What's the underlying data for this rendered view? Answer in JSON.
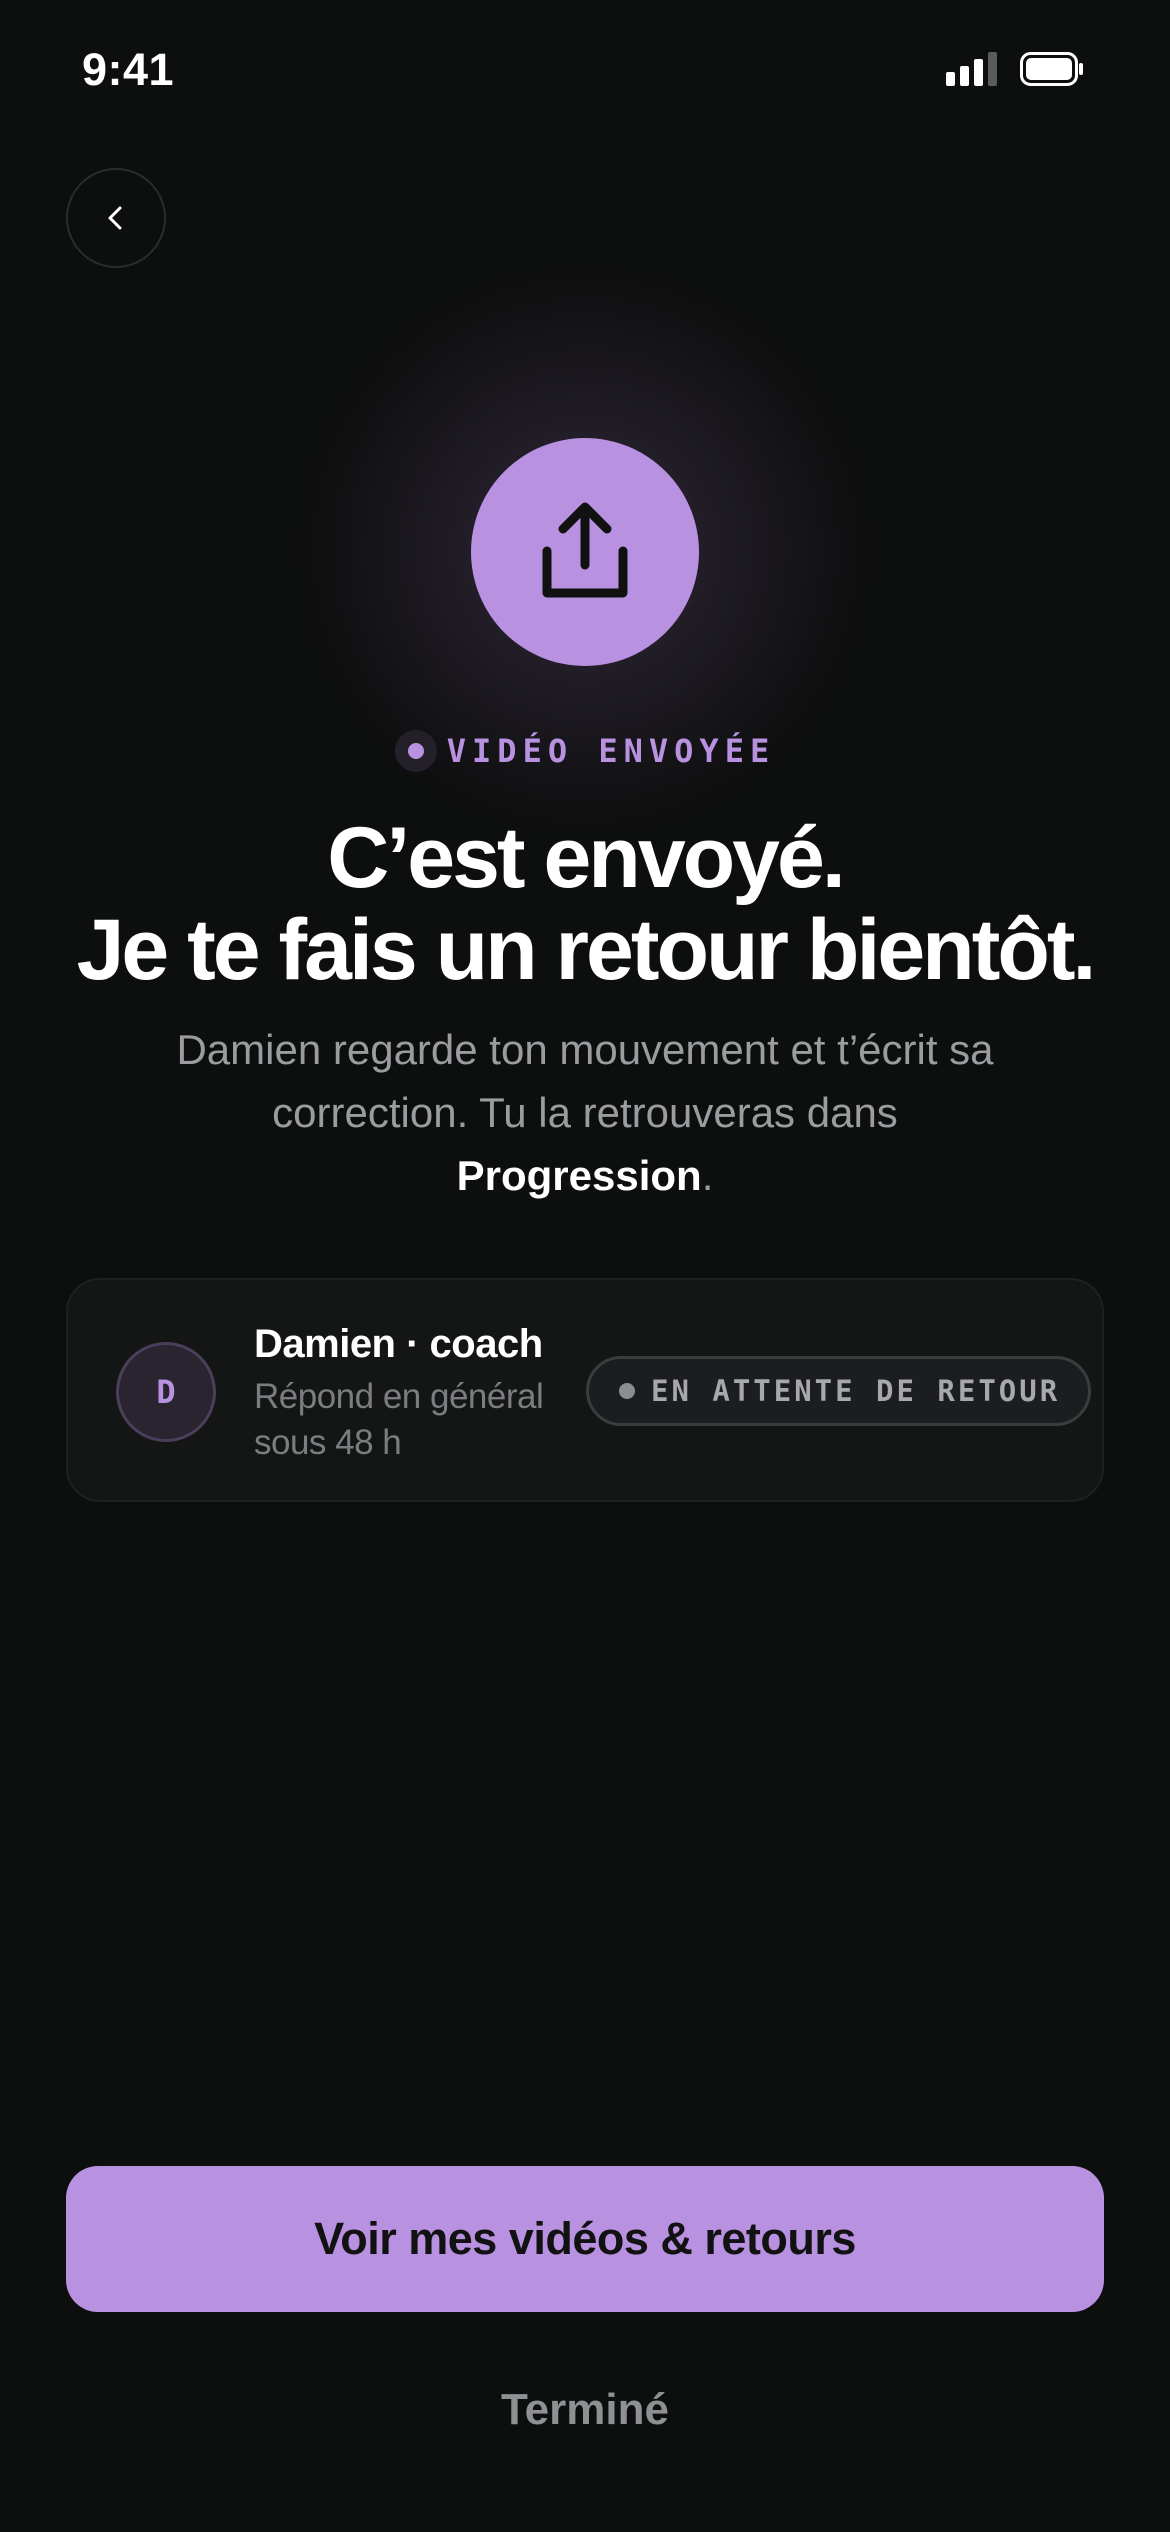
{
  "status_bar": {
    "time": "9:41",
    "signal_icon": "cellular-signal-icon",
    "battery_icon": "battery-icon"
  },
  "nav": {
    "back_icon": "chevron-left-icon"
  },
  "hero": {
    "icon": "upload-share-icon",
    "tag_label": "VIDÉO ENVOYÉE",
    "headline_line1": "C’est envoyé.",
    "headline_line2": "Je te fais un retour bientôt.",
    "body_prefix": "Damien regarde ton mouvement et t’écrit sa correction. Tu la retrouveras dans ",
    "body_highlight": "Progression",
    "body_suffix": "."
  },
  "coach_card": {
    "avatar_initial": "D",
    "name": "Damien · coach",
    "subtitle": "Répond en général sous 48 h",
    "status_pill": "EN ATTENTE DE RETOUR"
  },
  "actions": {
    "primary_label": "Voir mes vidéos & retours",
    "secondary_label": "Terminé"
  },
  "colors": {
    "background": "#0d0e0e",
    "accent": "#b891e0",
    "muted_text": "#9b9c9f"
  }
}
